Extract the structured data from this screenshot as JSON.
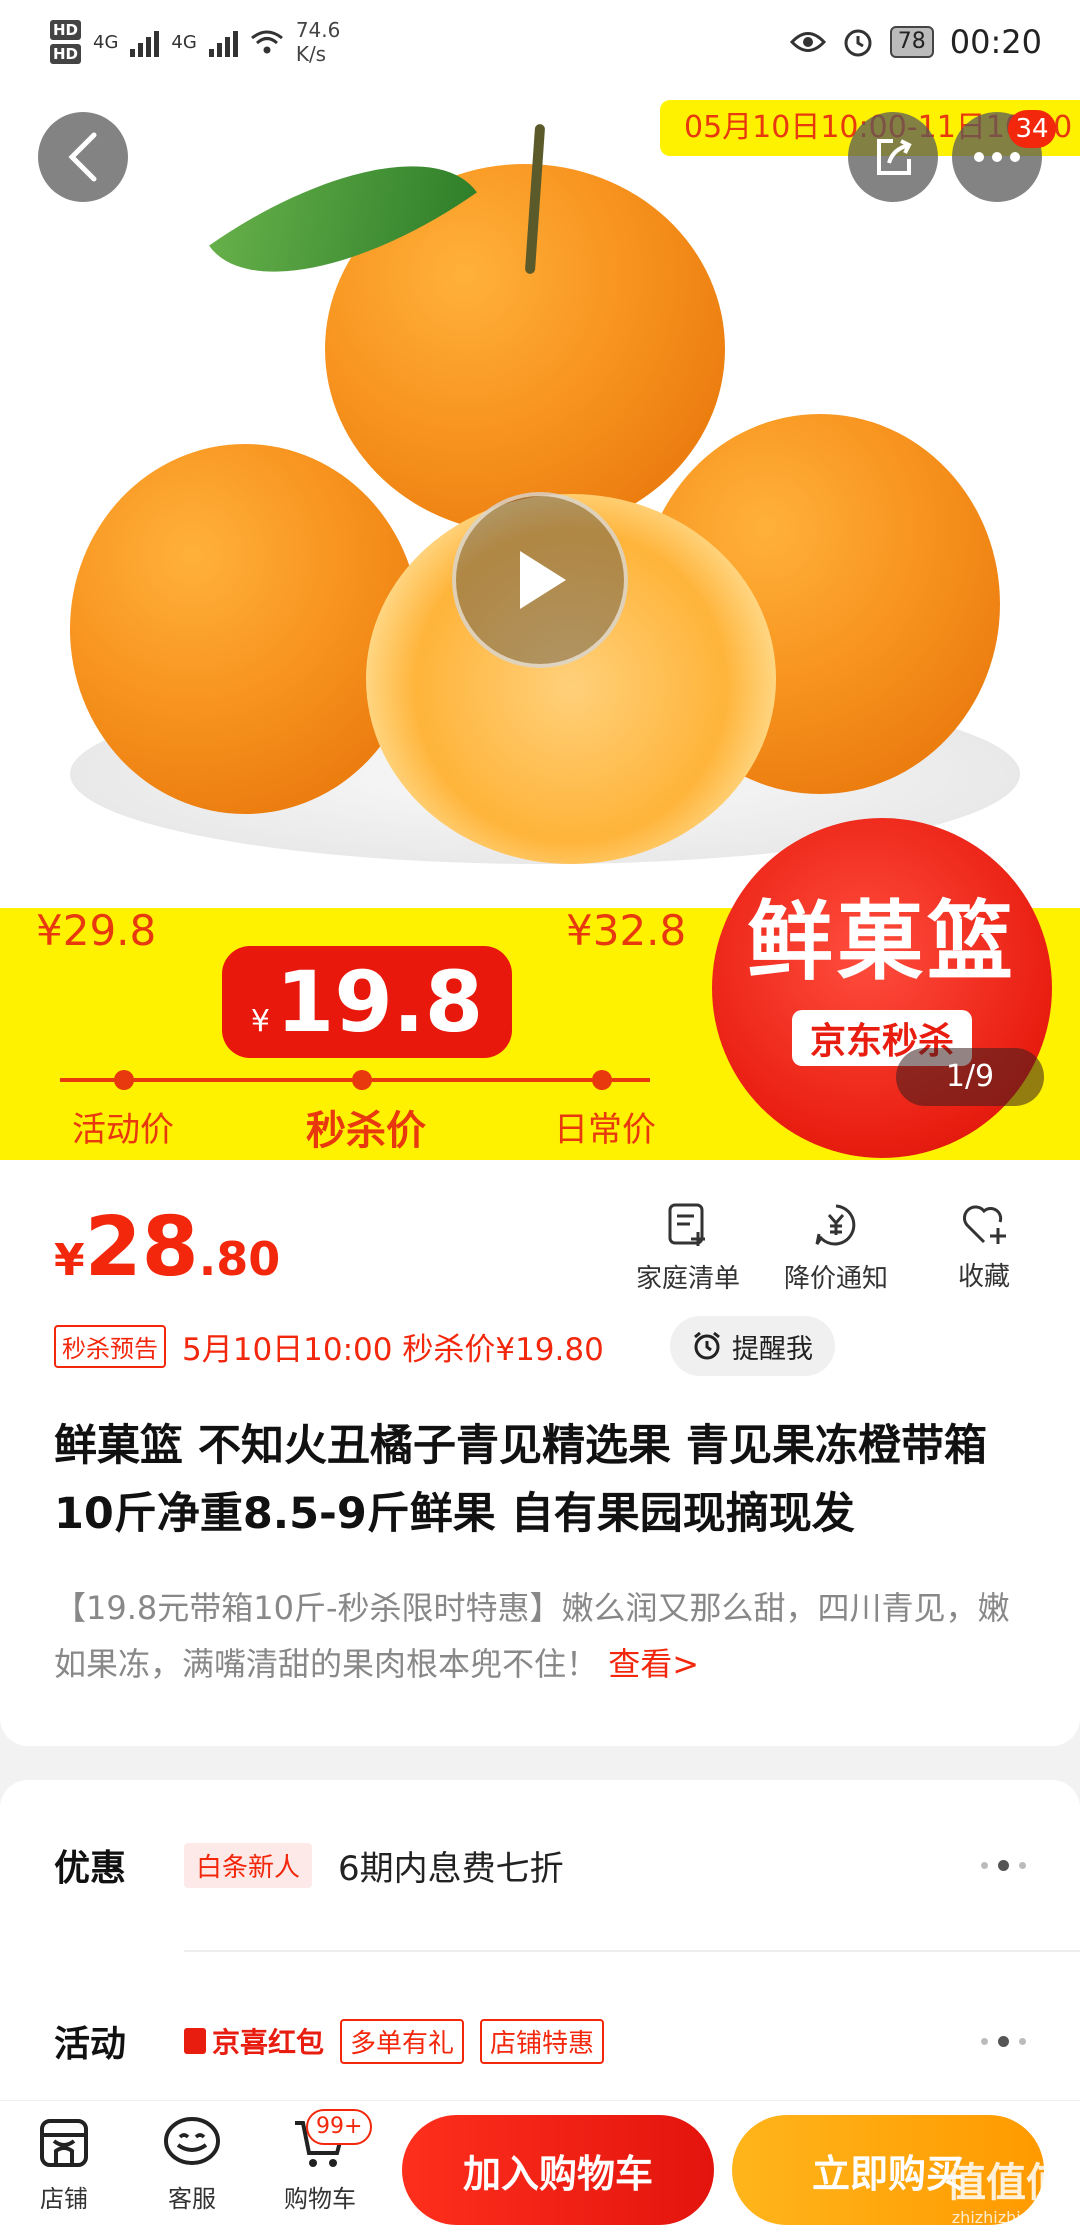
{
  "status_bar": {
    "hd1": "HD",
    "hd2": "HD",
    "net1": "4G",
    "net2": "4G",
    "speed_value": "74.6",
    "speed_unit": "K/s",
    "battery": "78",
    "time": "00:20"
  },
  "hero": {
    "sale_period": "05月10日10:00-11日10:00",
    "more_badge": "34",
    "image_counter": "1/9",
    "old_price_left": "¥29.8",
    "old_price_right": "¥32.8",
    "seckill_currency": "¥",
    "seckill_price": "19.8",
    "label_activity": "活动价",
    "label_seckill": "秒杀价",
    "label_daily": "日常价",
    "brand_name": "鲜菓篮",
    "brand_sub": "京东秒杀"
  },
  "product": {
    "price_currency": "¥",
    "price_int": "28",
    "price_dec": ".80",
    "actions": [
      {
        "label": "家庭清单",
        "icon": "list-add-icon"
      },
      {
        "label": "降价通知",
        "icon": "price-drop-icon"
      },
      {
        "label": "收藏",
        "icon": "heart-add-icon"
      }
    ],
    "presale_tag": "秒杀预告",
    "presale_text": "5月10日10:00 秒杀价¥19.80",
    "remind_label": "提醒我",
    "title": "鲜菓篮 不知火丑橘子青见精选果 青见果冻橙带箱10斤净重8.5-9斤鲜果 自有果园现摘现发",
    "description": "【19.8元带箱10斤-秒杀限时特惠】嫩么润又那么甜，四川青见，嫩如果冻，满嘴清甜的果肉根本兜不住！",
    "description_more": "查看>"
  },
  "offers": {
    "discount_label": "优惠",
    "discount_chip": "白条新人",
    "discount_text": "6期内息费七折",
    "activity_label": "活动",
    "activity_tags": [
      "京喜红包",
      "多单有礼",
      "店铺特惠"
    ]
  },
  "bottom_bar": {
    "shop_label": "店铺",
    "service_label": "客服",
    "cart_label": "购物车",
    "cart_badge": "99+",
    "add_to_cart": "加入购物车",
    "buy_now": "立即购买"
  },
  "watermark": {
    "text": "值值值",
    "sub": "zhizhizhi.com"
  },
  "colors": {
    "accent_red": "#f2270c",
    "buy_orange": "#ff9a00",
    "promo_yellow": "#fff200"
  }
}
